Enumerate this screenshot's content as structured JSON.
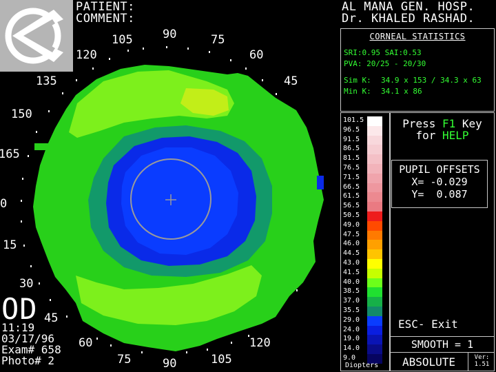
{
  "header": {
    "patient_label": "PATIENT:",
    "comment_label": "COMMENT:",
    "hospital": "AL MANA GEN. HOSP.",
    "doctor": "Dr. KHALED RASHAD."
  },
  "map": {
    "angle_labels": [
      "105",
      "90",
      "75",
      "120",
      "60",
      "135",
      "45",
      "150",
      "165",
      "0",
      "15",
      "30",
      "45",
      "60",
      "75",
      "90",
      "105",
      "120"
    ]
  },
  "stats": {
    "title": "CORNEAL STATISTICS",
    "sri_sai": "SRI:0.95 SAI:0.53",
    "pva": "PVA: 20/25 - 20/30",
    "sim_k_label": "Sim K:",
    "sim_k_value": "34.9 x 153 / 34.3 x 63",
    "min_k_label": "Min K:",
    "min_k_value": "34.1 x 86"
  },
  "scale": {
    "unit": "Diopters",
    "entries": [
      {
        "label": "101.5",
        "color": "#ffffff"
      },
      {
        "label": "96.5",
        "color": "#fce8ea"
      },
      {
        "label": "91.5",
        "color": "#f8d8dc"
      },
      {
        "label": "86.5",
        "color": "#f6cdd2"
      },
      {
        "label": "81.5",
        "color": "#f4c0c6"
      },
      {
        "label": "76.5",
        "color": "#f2b3ba"
      },
      {
        "label": "71.5",
        "color": "#f0a4ac"
      },
      {
        "label": "66.5",
        "color": "#ee979f"
      },
      {
        "label": "61.5",
        "color": "#ec8990"
      },
      {
        "label": "56.5",
        "color": "#ea7a82"
      },
      {
        "label": "50.5",
        "color": "#ee1c1c"
      },
      {
        "label": "49.0",
        "color": "#ff4a00"
      },
      {
        "label": "47.5",
        "color": "#ff7a00"
      },
      {
        "label": "46.0",
        "color": "#ffa000"
      },
      {
        "label": "44.5",
        "color": "#ffc400"
      },
      {
        "label": "43.0",
        "color": "#ffff00"
      },
      {
        "label": "41.5",
        "color": "#c6ff00"
      },
      {
        "label": "40.0",
        "color": "#6cff1a"
      },
      {
        "label": "38.5",
        "color": "#20e030"
      },
      {
        "label": "37.0",
        "color": "#16b048"
      },
      {
        "label": "35.5",
        "color": "#138a6a"
      },
      {
        "label": "29.0",
        "color": "#0a3cff"
      },
      {
        "label": "24.0",
        "color": "#0a1ee0"
      },
      {
        "label": "19.0",
        "color": "#0a14b4"
      },
      {
        "label": "14.0",
        "color": "#0a0c88"
      },
      {
        "label": "9.0",
        "color": "#060460"
      }
    ]
  },
  "help": {
    "line1_prefix": "Press ",
    "line1_key": "F1",
    "line1_suffix": " Key",
    "line2_prefix": "for ",
    "line2_word": "HELP"
  },
  "pupil": {
    "title": "PUPIL OFFSETS",
    "x": "X= -0.029",
    "y": "Y=  0.087"
  },
  "controls": {
    "esc": "ESC- Exit",
    "smooth": "SMOOTH = 1",
    "absolute": "ABSOLUTE",
    "ver_label": "Ver:",
    "ver_value": "1.51"
  },
  "exam": {
    "eye": "OD",
    "time": "11:19",
    "date": "03/17/96",
    "exam_no": "Exam# 658",
    "photo_no": "Photo# 2"
  },
  "colors": {
    "outer_green": "#28d01a",
    "light_green": "#7df01c",
    "yellow_green": "#c2ee18",
    "teal": "#12996a",
    "blue_ring": "#0a2ae8",
    "center_blue": "#0a3cff",
    "pupil_ring": "#9a9a9a"
  }
}
